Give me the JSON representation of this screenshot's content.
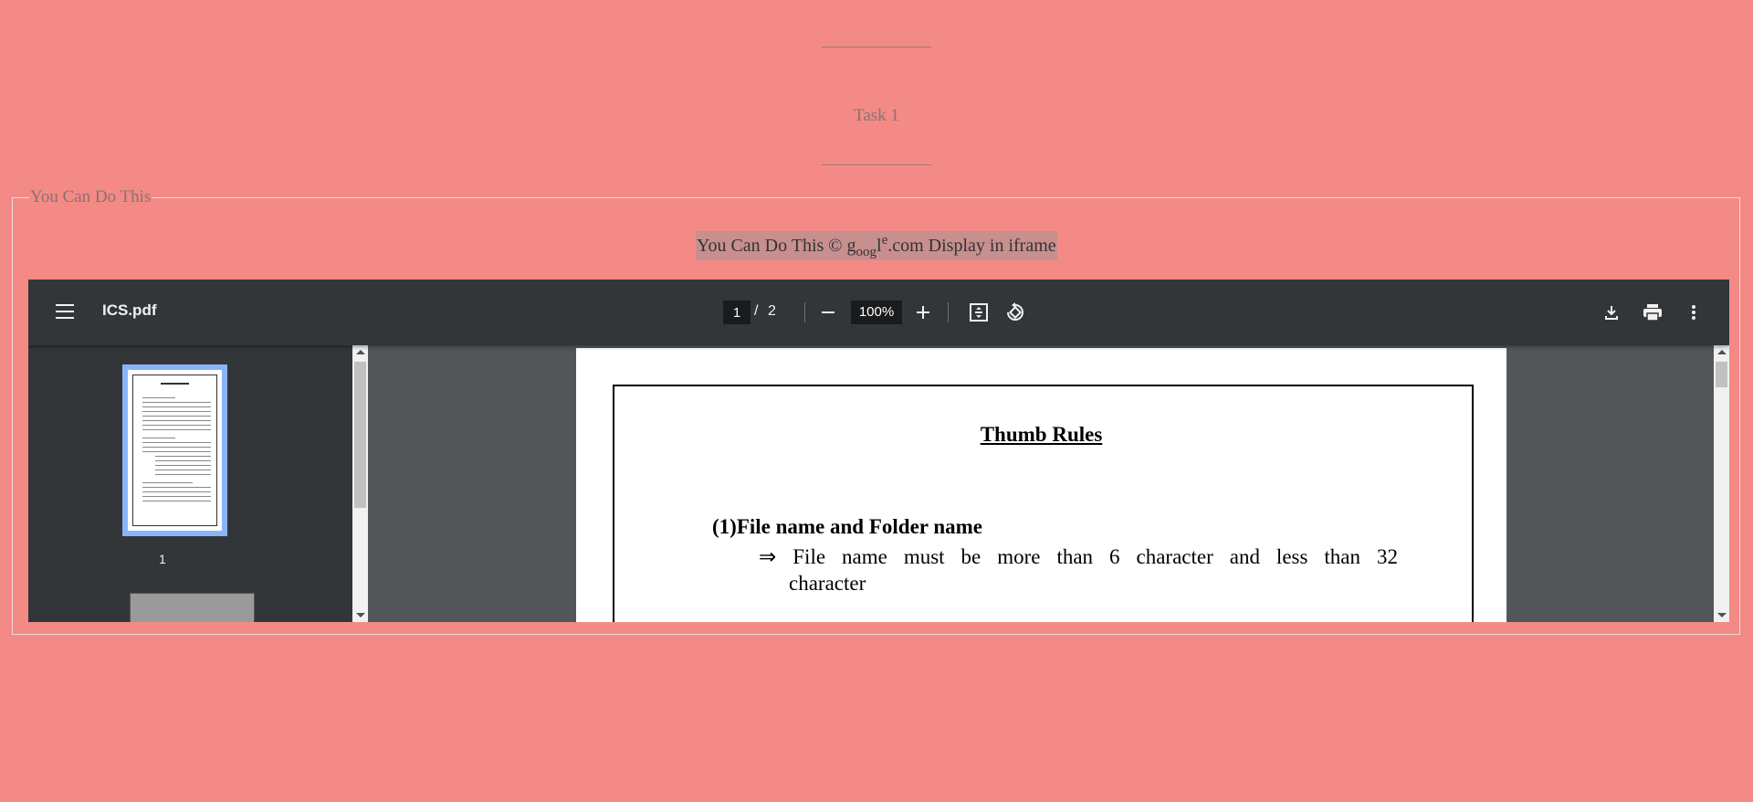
{
  "task": {
    "title": "Task 1"
  },
  "fieldset": {
    "legend": "You Can Do This"
  },
  "caption": {
    "part1": "You Can Do This © g",
    "part2": "oog",
    "part3": "l",
    "part4": "e",
    "part5": ".com Display in iframe"
  },
  "viewer": {
    "doc_title": "ICS.pdf",
    "page_current": "1",
    "page_sep": "/",
    "page_total": "2",
    "zoom": "100%",
    "thumb_label": "1"
  },
  "pdf": {
    "heading": "Thumb Rules",
    "section": "(1)File name and Folder name",
    "arrow": "⇒",
    "line1": "File name must be more than 6 character and less than 32",
    "line2": "character"
  },
  "colors": {
    "background": "#f48a86",
    "toolbar": "#323639",
    "viewer_bg": "#525659",
    "thumb_highlight": "#8ab4f8"
  }
}
